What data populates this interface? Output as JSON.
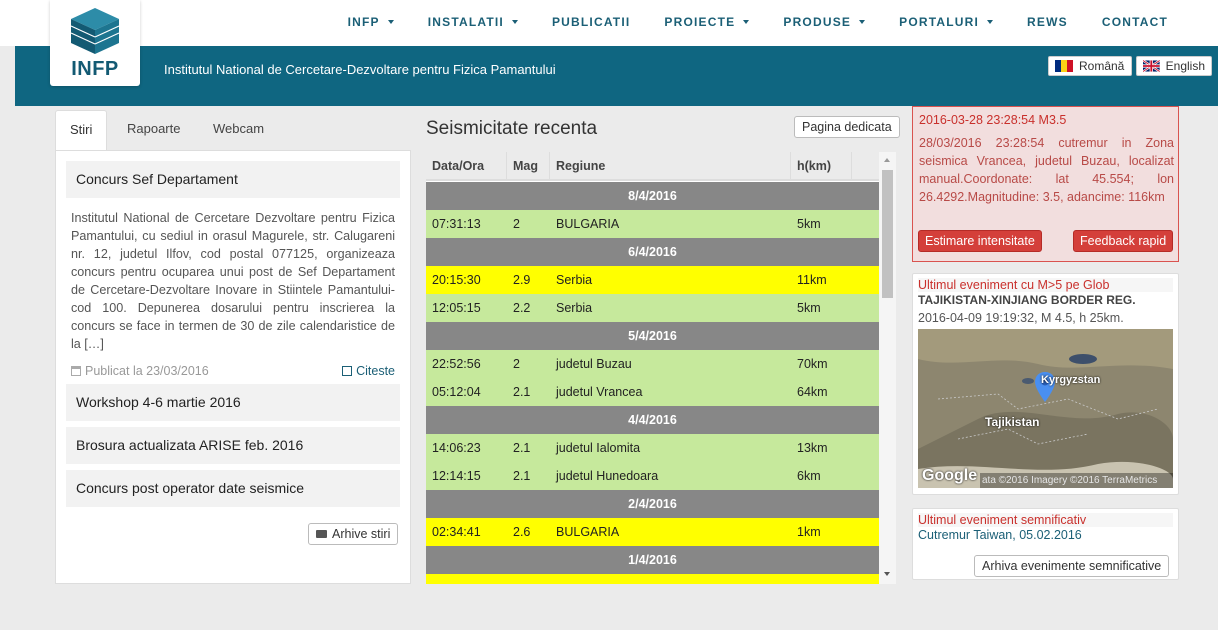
{
  "nav": [
    {
      "label": "INFP",
      "dropdown": true
    },
    {
      "label": "INSTALATII",
      "dropdown": true
    },
    {
      "label": "PUBLICATII",
      "dropdown": false
    },
    {
      "label": "PROIECTE",
      "dropdown": true
    },
    {
      "label": "PRODUSE",
      "dropdown": true
    },
    {
      "label": "PORTALURI",
      "dropdown": true
    },
    {
      "label": "REWS",
      "dropdown": false
    },
    {
      "label": "CONTACT",
      "dropdown": false
    }
  ],
  "header": {
    "logo_text": "INFP",
    "title": "Institutul National de Cercetare-Dezvoltare pentru Fizica Pamantului",
    "lang_ro": "Română",
    "lang_en": "English"
  },
  "tabs": [
    "Stiri",
    "Rapoarte",
    "Webcam"
  ],
  "news": {
    "featured_title": "Concurs Sef Departament",
    "featured_text": "Institutul National de Cercetare Dezvoltare pentru Fizica Pamantului, cu sediul in orasul Magurele, str. Calugareni nr. 12, judetul Ilfov, cod postal 077125, organizeaza concurs pentru ocuparea unui post de Sef Departament de Cercetare-Dezvoltare Inovare in Stiintele Pamantului-cod 100. Depunerea dosarului pentru inscrierea la concurs se face in termen de 30 de zile calendaristice de la […]",
    "date": "Publicat la 23/03/2016",
    "read_label": "Citeste",
    "items": [
      "Workshop 4-6 martie 2016",
      "Brosura actualizata ARISE feb. 2016",
      "Concurs post operator date seismice"
    ],
    "archive_label": "Arhive stiri"
  },
  "seismic": {
    "title": "Seismicitate recenta",
    "dedicated_label": "Pagina dedicata",
    "columns": [
      "Data/Ora",
      "Mag",
      "Regiune",
      "h(km)"
    ],
    "rows": [
      {
        "type": "date",
        "label": "8/4/2016"
      },
      {
        "type": "event",
        "time": "07:31:13",
        "mag": "2",
        "region": "BULGARIA",
        "depth": "5km",
        "color": "green"
      },
      {
        "type": "date",
        "label": "6/4/2016"
      },
      {
        "type": "event",
        "time": "20:15:30",
        "mag": "2.9",
        "region": "Serbia",
        "depth": "11km",
        "color": "yellow"
      },
      {
        "type": "event",
        "time": "12:05:15",
        "mag": "2.2",
        "region": "Serbia",
        "depth": "5km",
        "color": "green"
      },
      {
        "type": "date",
        "label": "5/4/2016"
      },
      {
        "type": "event",
        "time": "22:52:56",
        "mag": "2",
        "region": "judetul Buzau",
        "depth": "70km",
        "color": "green"
      },
      {
        "type": "event",
        "time": "05:12:04",
        "mag": "2.1",
        "region": "judetul Vrancea",
        "depth": "64km",
        "color": "green"
      },
      {
        "type": "date",
        "label": "4/4/2016"
      },
      {
        "type": "event",
        "time": "14:06:23",
        "mag": "2.1",
        "region": "judetul Ialomita",
        "depth": "13km",
        "color": "green"
      },
      {
        "type": "event",
        "time": "12:14:15",
        "mag": "2.1",
        "region": "judetul Hunedoara",
        "depth": "6km",
        "color": "green"
      },
      {
        "type": "date",
        "label": "2/4/2016"
      },
      {
        "type": "event",
        "time": "02:34:41",
        "mag": "2.6",
        "region": "BULGARIA",
        "depth": "1km",
        "color": "yellow"
      },
      {
        "type": "date",
        "label": "1/4/2016"
      },
      {
        "type": "event",
        "time": "",
        "mag": "",
        "region": "",
        "depth": "",
        "color": "yellow"
      }
    ]
  },
  "alert": {
    "head": "2016-03-28 23:28:54 M3.5",
    "text": "28/03/2016 23:28:54 cutremur in Zona seismica Vrancea, judetul Buzau, localizat manual.Coordonate: lat 45.554; lon 26.4292.Magnitudine: 3.5, adancime: 116km",
    "btn_intensity": "Estimare intensitate",
    "btn_feedback": "Feedback rapid"
  },
  "global_event": {
    "head": "Ultimul eveniment cu M>5 pe Glob",
    "region": "TAJIKISTAN-XINJIANG BORDER REG.",
    "details": "2016-04-09 19:19:32, M 4.5, h 25km.",
    "map_label_country": "Tajikistan",
    "map_label_kyrgyz": "Kyrgyzstan",
    "map_logo": "Google",
    "map_attribution": "ata ©2016 Imagery ©2016 TerraMetrics"
  },
  "significant": {
    "head": "Ultimul eveniment semnificativ",
    "text": "Cutremur Taiwan, 05.02.2016",
    "archive_label": "Arhiva evenimente semnificative"
  },
  "colors": {
    "banner": "#0f6681",
    "nav_text": "#1b5f76",
    "row_green": "#c6e99c",
    "row_yellow": "#ffff00",
    "date_row": "#878787",
    "alert_red": "#d43f3a"
  }
}
